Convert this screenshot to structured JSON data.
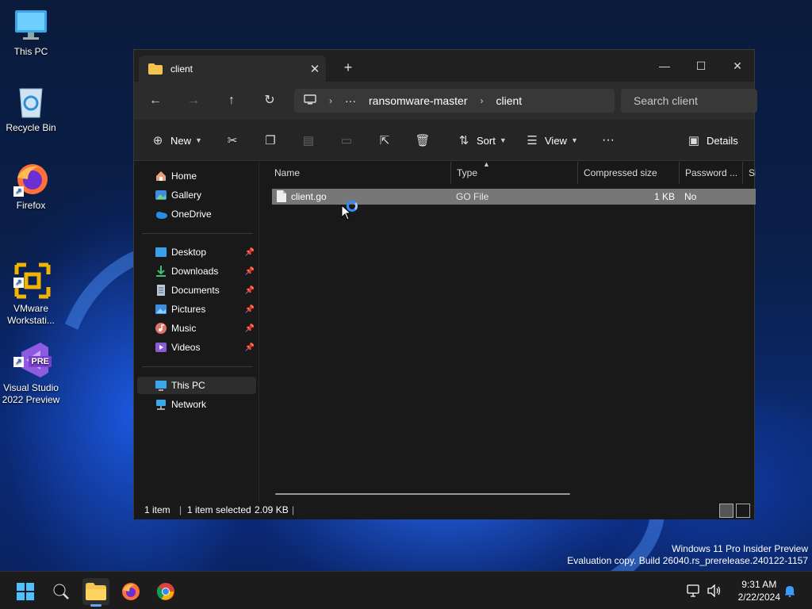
{
  "desktop": {
    "icons": [
      {
        "label": "This PC",
        "icon": "monitor-icon"
      },
      {
        "label": "Recycle Bin",
        "icon": "recycle-bin-icon"
      },
      {
        "label": "Firefox",
        "icon": "firefox-icon"
      },
      {
        "label": "VMware\nWorkstati...",
        "icon": "vmware-icon"
      },
      {
        "label": "Visual Studio\n2022 Preview",
        "icon": "visual-studio-icon",
        "badge": "PRE"
      }
    ],
    "watermark_line1": "Windows 11 Pro Insider Preview",
    "watermark_line2": "Evaluation copy. Build 26040.rs_prerelease.240122-1157"
  },
  "explorer": {
    "tab_title": "client",
    "new_tab_symbol": "+",
    "tab_close_symbol": "✕",
    "window_controls": {
      "minimize": "—",
      "maximize": "☐",
      "close": "✕"
    },
    "address": {
      "ellipsis": "···",
      "segments": [
        "ransomware-master",
        "client"
      ],
      "separator": "›"
    },
    "search_placeholder": "Search client",
    "commands": {
      "new_label": "New",
      "sort_label": "Sort",
      "view_label": "View",
      "more_label": "···",
      "details_label": "Details"
    },
    "nav": {
      "group1": [
        {
          "label": "Home",
          "icon": "home-icon"
        },
        {
          "label": "Gallery",
          "icon": "gallery-icon"
        },
        {
          "label": "OneDrive",
          "icon": "onedrive-icon"
        }
      ],
      "group2": [
        {
          "label": "Desktop",
          "icon": "desktop-folder-icon"
        },
        {
          "label": "Downloads",
          "icon": "downloads-icon"
        },
        {
          "label": "Documents",
          "icon": "documents-icon"
        },
        {
          "label": "Pictures",
          "icon": "pictures-icon"
        },
        {
          "label": "Music",
          "icon": "music-icon"
        },
        {
          "label": "Videos",
          "icon": "videos-icon"
        }
      ],
      "group3": [
        {
          "label": "This PC",
          "icon": "this-pc-icon",
          "selected": true
        },
        {
          "label": "Network",
          "icon": "network-icon"
        }
      ]
    },
    "columns": [
      "Name",
      "Type",
      "Compressed size",
      "Password ...",
      "Si"
    ],
    "files": [
      {
        "name": "client.go",
        "type": "GO File",
        "compressed_size": "1 KB",
        "password": "No",
        "selected": true
      }
    ],
    "status": {
      "count": "1 item",
      "selected": "1 item selected",
      "size": "2.09 KB"
    }
  },
  "taskbar": {
    "time": "9:31 AM",
    "date": "2/22/2024",
    "apps": [
      "start-icon",
      "search-icon",
      "file-explorer-icon",
      "firefox-icon",
      "chrome-icon"
    ]
  },
  "colors": {
    "accent": "#60a8ff",
    "selected_row": "#777777",
    "window_bg": "#191919"
  }
}
